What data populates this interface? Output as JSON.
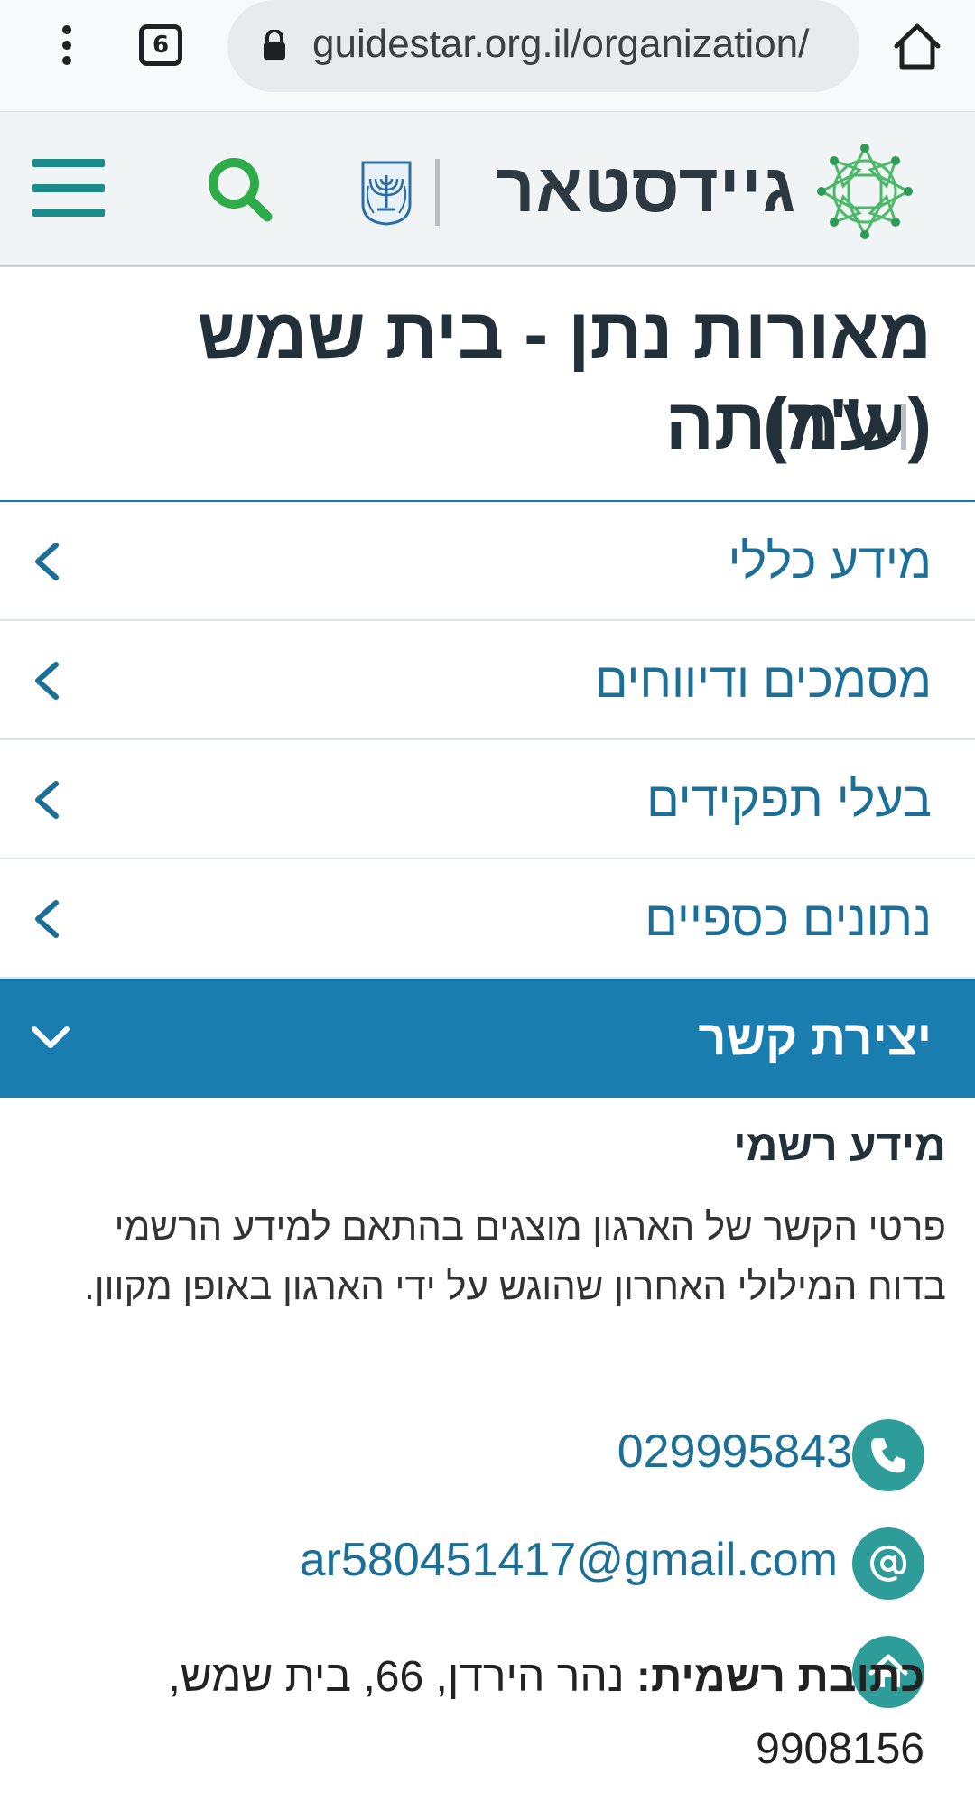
{
  "browser": {
    "tab_count": "6",
    "url": "guidestar.org.il/organization/"
  },
  "site": {
    "logo_text": "גיידסטאר",
    "logo_name": "guidestar-logo",
    "accent_color": "#1a7daf",
    "teal_color": "#2e9c98",
    "search_color": "#2fac4a"
  },
  "organization": {
    "name": "מאורות נתן - בית שמש (ע\"ר)",
    "type": "עמותה"
  },
  "accordion": {
    "items": [
      {
        "label": "מידע כללי"
      },
      {
        "label": "מסמכים ודיווחים"
      },
      {
        "label": "בעלי תפקידים"
      },
      {
        "label": "נתונים כספיים"
      }
    ],
    "active": {
      "label": "יצירת קשר"
    }
  },
  "contact": {
    "heading": "מידע רשמי",
    "description": "פרטי הקשר של הארגון מוצגים בהתאם למידע הרשמי בדוח המילולי האחרון שהוגש על ידי הארגון באופן מקוון.",
    "phone": "029995843",
    "email": "ar580451417@gmail.com",
    "address_label": "כתובת רשמית:",
    "address_value": "נהר הירדן, 66, בית שמש, 9908156"
  },
  "icons": {
    "menu": "menu-dots-icon",
    "home": "home-icon",
    "lock": "lock-icon",
    "hamburger": "hamburger-icon",
    "search": "search-icon",
    "emblem": "state-emblem-icon",
    "phone": "phone-icon",
    "email": "at-sign-icon",
    "address": "house-icon",
    "chevron": "chevron-left-icon",
    "chevron_down": "chevron-down-icon"
  }
}
